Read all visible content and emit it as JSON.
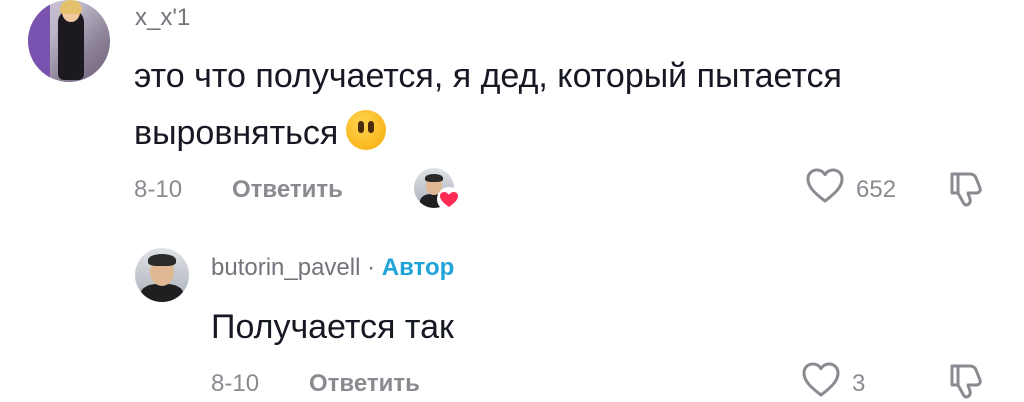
{
  "comment": {
    "username": "x_x'1",
    "text_line1": "это что получается, я дед, который пытается",
    "text_line2": "выровняться",
    "date": "8-10",
    "reply_label": "Ответить",
    "likes": "652"
  },
  "reply": {
    "username": "butorin_pavell",
    "separator": "·",
    "badge": "Автор",
    "text": "Получается так",
    "date": "8-10",
    "reply_label": "Ответить",
    "likes": "3"
  },
  "colors": {
    "author_badge": "#1fa3d8",
    "liked_heart": "#fe2c55",
    "text": "#161823",
    "muted": "#8a8b91"
  },
  "icons": {
    "like": "heart-outline-icon",
    "dislike": "thumbs-down-icon",
    "emoji": "face-without-mouth-emoji",
    "creator_liked": "creator-liked-heart-icon"
  }
}
